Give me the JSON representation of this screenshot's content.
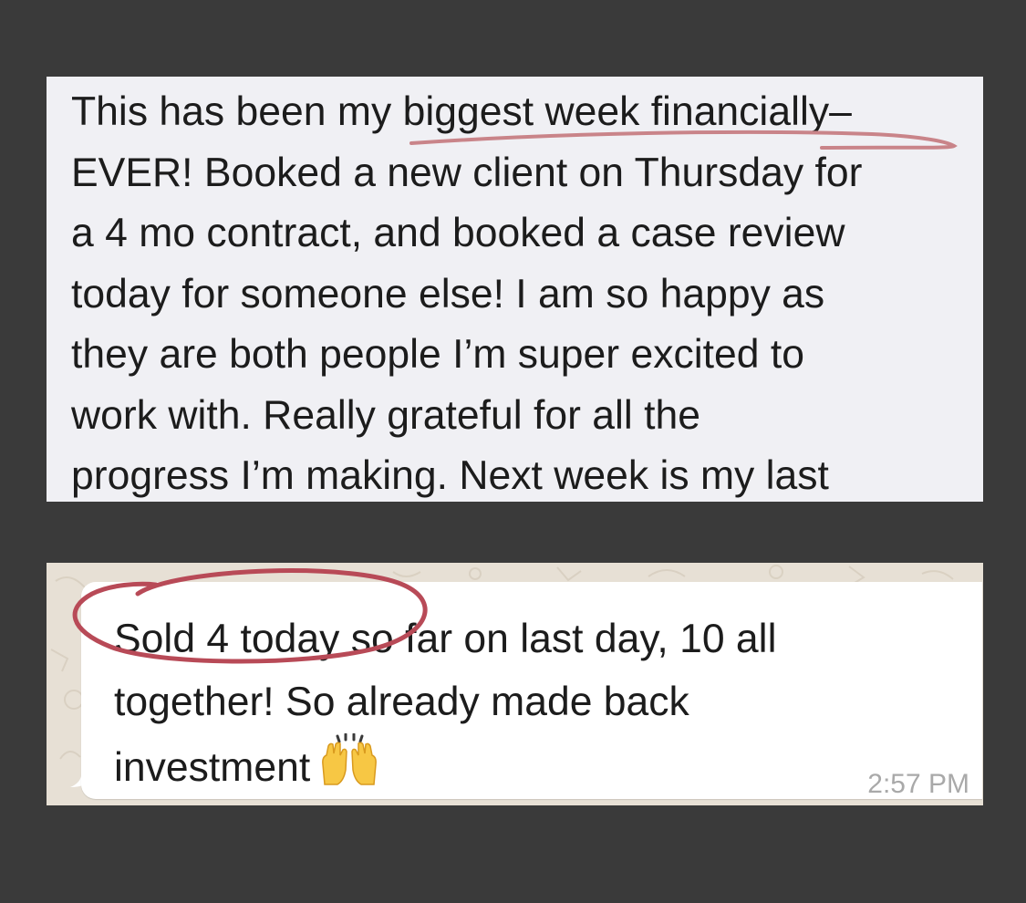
{
  "message_top": {
    "lines": [
      "This has been my biggest week financially–",
      "EVER! Booked a new client on Thursday for",
      "a 4 mo contract, and booked a case review",
      "today for someone else! I am so happy as",
      "they are both people I’m super excited to",
      "work with. Really grateful for all the",
      "progress I’m making. Next week is my last"
    ],
    "highlight_color": "#c98489"
  },
  "message_bottom": {
    "lines": [
      "Sold 4 today so far on last day, 10 all",
      "together! So already made back",
      "investment"
    ],
    "emoji": "raising-hands-emoji",
    "timestamp": "2:57 PM",
    "highlight_color": "#b84a57"
  },
  "colors": {
    "background": "#3a3a3a",
    "card_top": "#f0f0f4",
    "wallpaper": "#e6dfd4",
    "bubble": "#ffffff",
    "text": "#1c1c1c",
    "timestamp": "#a9a9a9"
  }
}
